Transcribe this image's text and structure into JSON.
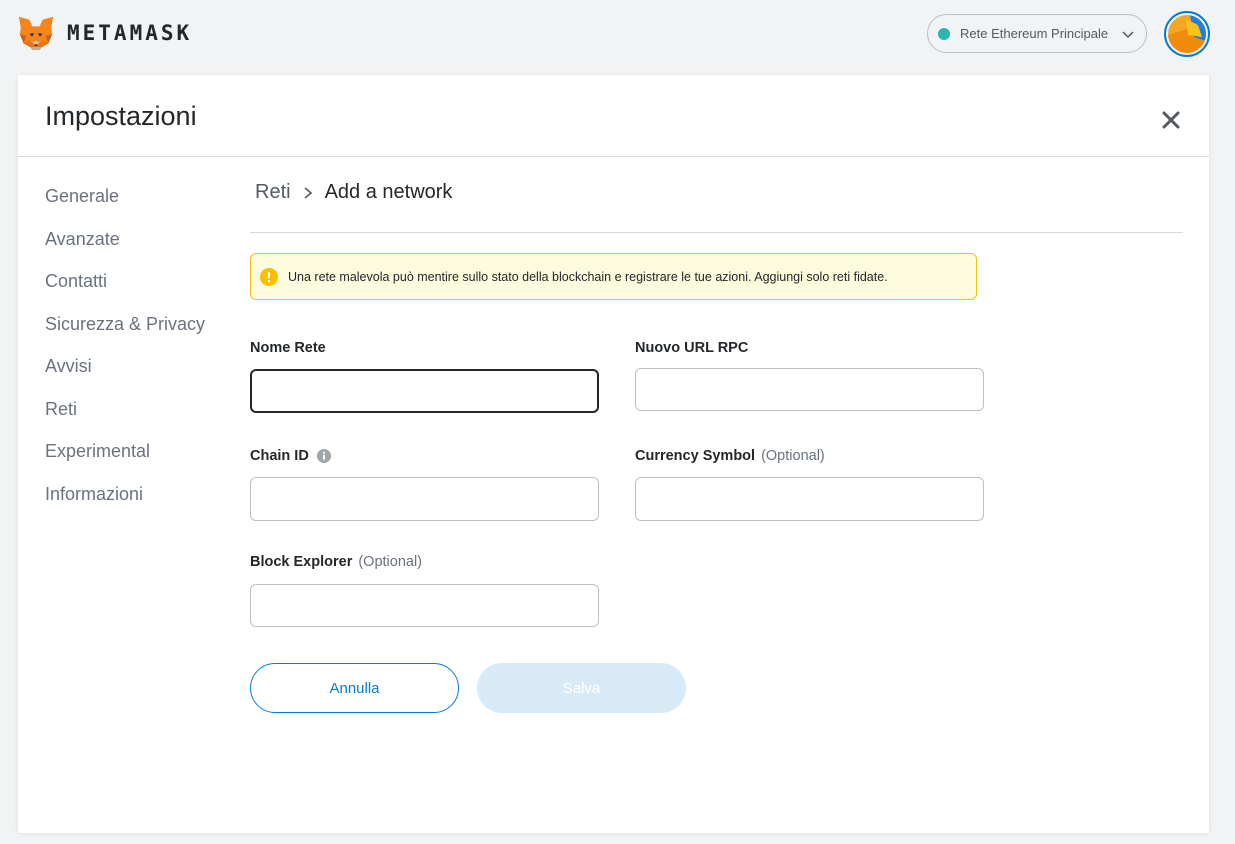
{
  "app": {
    "wordmark": "METAMASK",
    "logo_icon": "metamask-fox-icon"
  },
  "network": {
    "label": "Rete Ethereum Principale",
    "dot_color": "#29b6af"
  },
  "settings": {
    "title": "Impostazioni",
    "sidebar": [
      {
        "label": "Generale"
      },
      {
        "label": "Avanzate"
      },
      {
        "label": "Contatti"
      },
      {
        "label": "Sicurezza & Privacy"
      },
      {
        "label": "Avvisi"
      },
      {
        "label": "Reti"
      },
      {
        "label": "Experimental"
      },
      {
        "label": "Informazioni"
      }
    ]
  },
  "breadcrumb": {
    "root": "Reti",
    "current": "Add a network"
  },
  "warning": {
    "text": "Una rete malevola può mentire sullo stato della blockchain e registrare le tue azioni. Aggiungi solo reti fidate."
  },
  "form": {
    "network_name": {
      "label": "Nome Rete",
      "value": ""
    },
    "rpc_url": {
      "label": "Nuovo URL RPC",
      "value": ""
    },
    "chain_id": {
      "label": "Chain ID",
      "value": ""
    },
    "currency_symbol": {
      "label": "Currency Symbol",
      "optional": "(Optional)",
      "value": ""
    },
    "block_explorer": {
      "label": "Block Explorer",
      "optional": "(Optional)",
      "value": ""
    }
  },
  "buttons": {
    "cancel": "Annulla",
    "save": "Salva"
  },
  "colors": {
    "accent": "#037dd6",
    "warning_border": "#f8c000",
    "warning_bg": "#fefcde",
    "save_disabled_bg": "#d8eaf8"
  }
}
